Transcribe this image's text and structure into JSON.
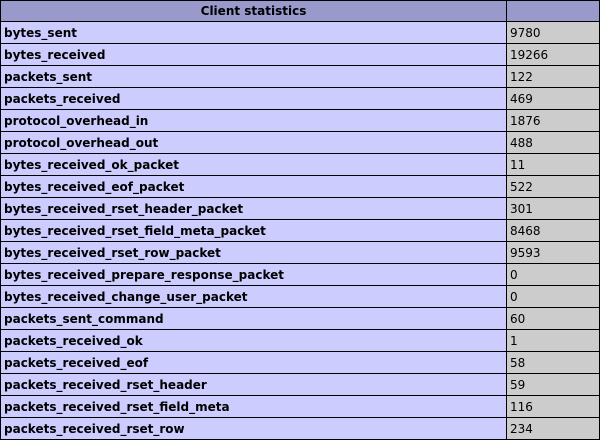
{
  "header": {
    "title": "Client statistics",
    "value_header": ""
  },
  "rows": [
    {
      "name": "bytes_sent",
      "value": "9780"
    },
    {
      "name": "bytes_received",
      "value": "19266"
    },
    {
      "name": "packets_sent",
      "value": "122"
    },
    {
      "name": "packets_received",
      "value": "469"
    },
    {
      "name": "protocol_overhead_in",
      "value": "1876"
    },
    {
      "name": "protocol_overhead_out",
      "value": "488"
    },
    {
      "name": "bytes_received_ok_packet",
      "value": "11"
    },
    {
      "name": "bytes_received_eof_packet",
      "value": "522"
    },
    {
      "name": "bytes_received_rset_header_packet",
      "value": "301"
    },
    {
      "name": "bytes_received_rset_field_meta_packet",
      "value": "8468"
    },
    {
      "name": "bytes_received_rset_row_packet",
      "value": "9593"
    },
    {
      "name": "bytes_received_prepare_response_packet",
      "value": "0"
    },
    {
      "name": "bytes_received_change_user_packet",
      "value": "0"
    },
    {
      "name": "packets_sent_command",
      "value": "60"
    },
    {
      "name": "packets_received_ok",
      "value": "1"
    },
    {
      "name": "packets_received_eof",
      "value": "58"
    },
    {
      "name": "packets_received_rset_header",
      "value": "59"
    },
    {
      "name": "packets_received_rset_field_meta",
      "value": "116"
    },
    {
      "name": "packets_received_rset_row",
      "value": "234"
    }
  ]
}
